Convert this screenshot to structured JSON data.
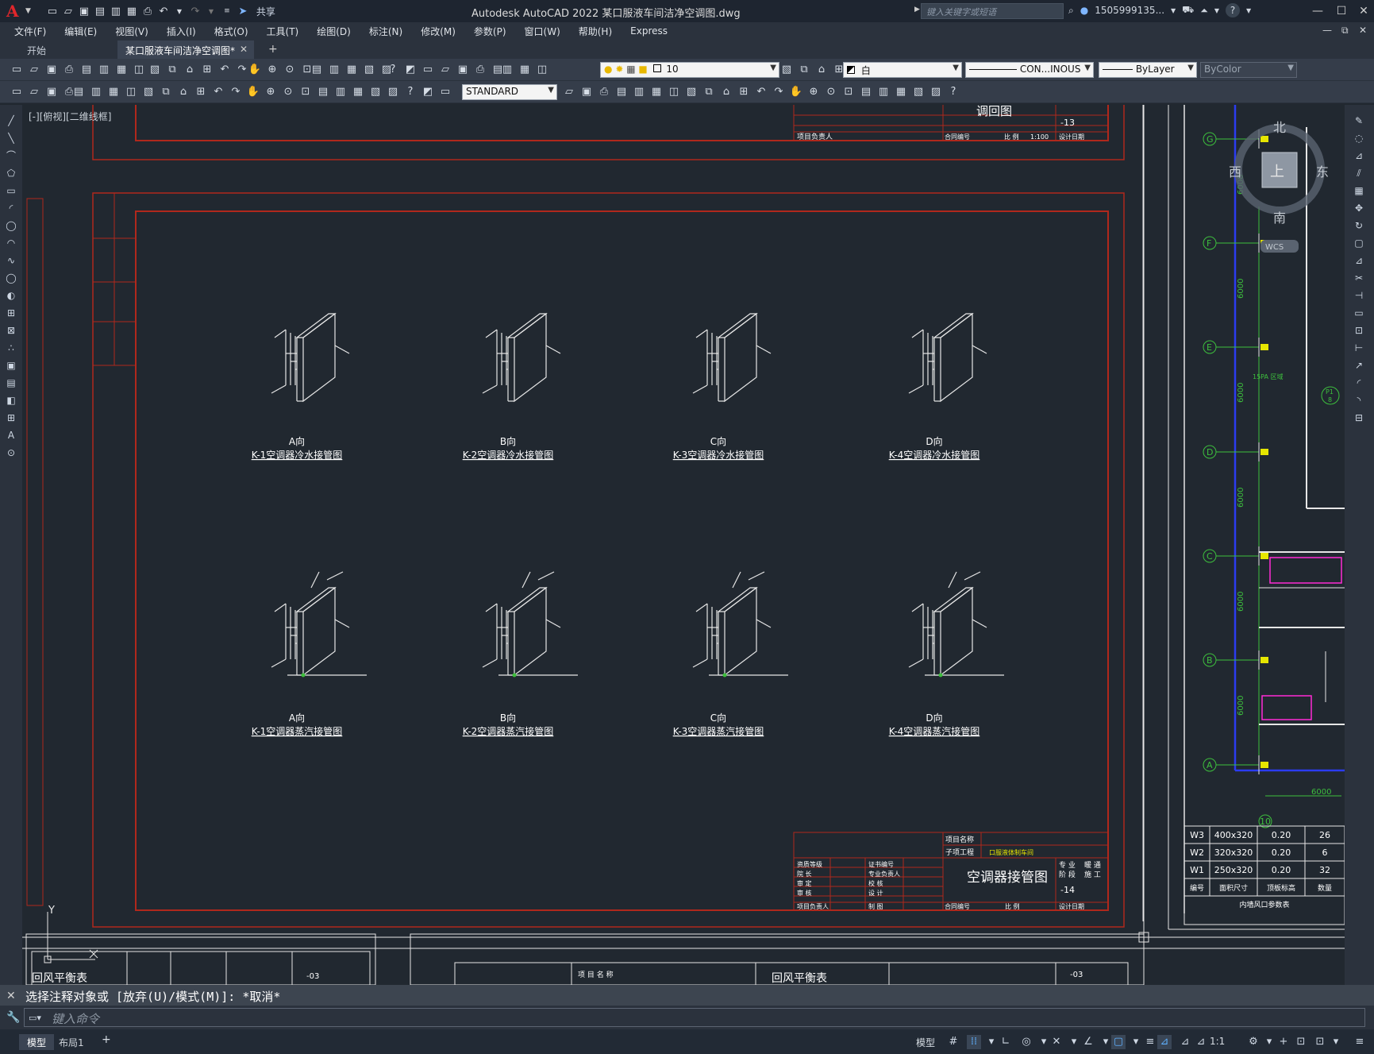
{
  "app": {
    "title": "Autodesk AutoCAD 2022    某口服液车间洁净空调图.dwg",
    "logo": "A",
    "share_label": "共享",
    "search_placeholder": "键入关键字或短语",
    "user": "1505999135...",
    "help": "?"
  },
  "menu": [
    "文件(F)",
    "编辑(E)",
    "视图(V)",
    "插入(I)",
    "格式(O)",
    "工具(T)",
    "绘图(D)",
    "标注(N)",
    "修改(M)",
    "参数(P)",
    "窗口(W)",
    "帮助(H)",
    "Express"
  ],
  "tabs": [
    {
      "label": "开始",
      "active": false
    },
    {
      "label": "某口服液车间洁净空调图*",
      "active": true
    }
  ],
  "toolbar1": {
    "layer": "10",
    "color": "白",
    "linetype": "CON...INOUS",
    "lineweight": "ByLayer",
    "plotstyle": "ByColor"
  },
  "toolbar2": {
    "textstyle": "STANDARD"
  },
  "viewport_label": "[-][俯视][二维线框]",
  "viewcube": {
    "north": "北",
    "south": "南",
    "east": "东",
    "west": "西",
    "top": "上",
    "wcs": "WCS"
  },
  "drawing": {
    "top_titleblock": {
      "title": "调回图",
      "sheet": "-13",
      "scale": "1:100",
      "contract_label": "合同编号",
      "scale_label": "比 例",
      "date_label": "设计日期",
      "leader_label": "项目负责人"
    },
    "row1": [
      {
        "dir": "A向",
        "caption": "K-1空调器冷水接管图"
      },
      {
        "dir": "B向",
        "caption": "K-2空调器冷水接管图"
      },
      {
        "dir": "C向",
        "caption": "K-3空调器冷水接管图"
      },
      {
        "dir": "D向",
        "caption": "K-4空调器冷水接管图"
      }
    ],
    "row2": [
      {
        "dir": "A向",
        "caption": "K-1空调器蒸汽接管图"
      },
      {
        "dir": "B向",
        "caption": "K-2空调器蒸汽接管图"
      },
      {
        "dir": "C向",
        "caption": "K-3空调器蒸汽接管图"
      },
      {
        "dir": "D向",
        "caption": "K-4空调器蒸汽接管图"
      }
    ],
    "titleblock": {
      "project_label": "项目名称",
      "subproject_label": "子项工程",
      "subproject": "口服液体制车间",
      "title": "空调器接管图",
      "sheet": "-14",
      "contract_label": "合同编号",
      "scale_label": "比 例",
      "date_label": "设计日期",
      "leader_label": "项目负责人",
      "rows": [
        "资质等级",
        "院    长",
        "审    定",
        "审    核"
      ],
      "row_right": [
        "证书编号",
        "专业负责人",
        "校    核",
        "设    计",
        "制    图"
      ],
      "discipline": [
        "专 业",
        "阶 段",
        "暖 通",
        "施 工"
      ]
    },
    "bottom_left_title": "回风平衡表",
    "bottom_mid_label": "项 目 名 称",
    "bottom_mid_title": "回风平衡表",
    "bottom_sheet": "-03",
    "grid_axes": [
      "G",
      "F",
      "E",
      "D",
      "C",
      "B",
      "A"
    ],
    "grid_dims": [
      "6000",
      "6000",
      "6000",
      "6000",
      "6000",
      "6000"
    ],
    "grid_col": "10",
    "grid_width": "6000",
    "table": {
      "rows": [
        [
          "W3",
          "400x320",
          "0.20",
          "26"
        ],
        [
          "W2",
          "320x320",
          "0.20",
          "6"
        ],
        [
          "W1",
          "250x320",
          "0.20",
          "32"
        ]
      ],
      "header": [
        "编号",
        "面积尺寸",
        "顶板标高",
        "数量"
      ],
      "caption": "内墙风口参数表"
    },
    "pt_label": "P1",
    "pt_num": "8",
    "green_label": "15PA 区域"
  },
  "command": {
    "history": "选择注释对象或 [放弃(U)/模式(M)]: *取消*",
    "placeholder": "键入命令"
  },
  "status": {
    "tabs": [
      {
        "label": "模型",
        "active": true
      },
      {
        "label": "布局1",
        "active": false
      }
    ],
    "model_label": "模型",
    "scale": "1:1"
  }
}
